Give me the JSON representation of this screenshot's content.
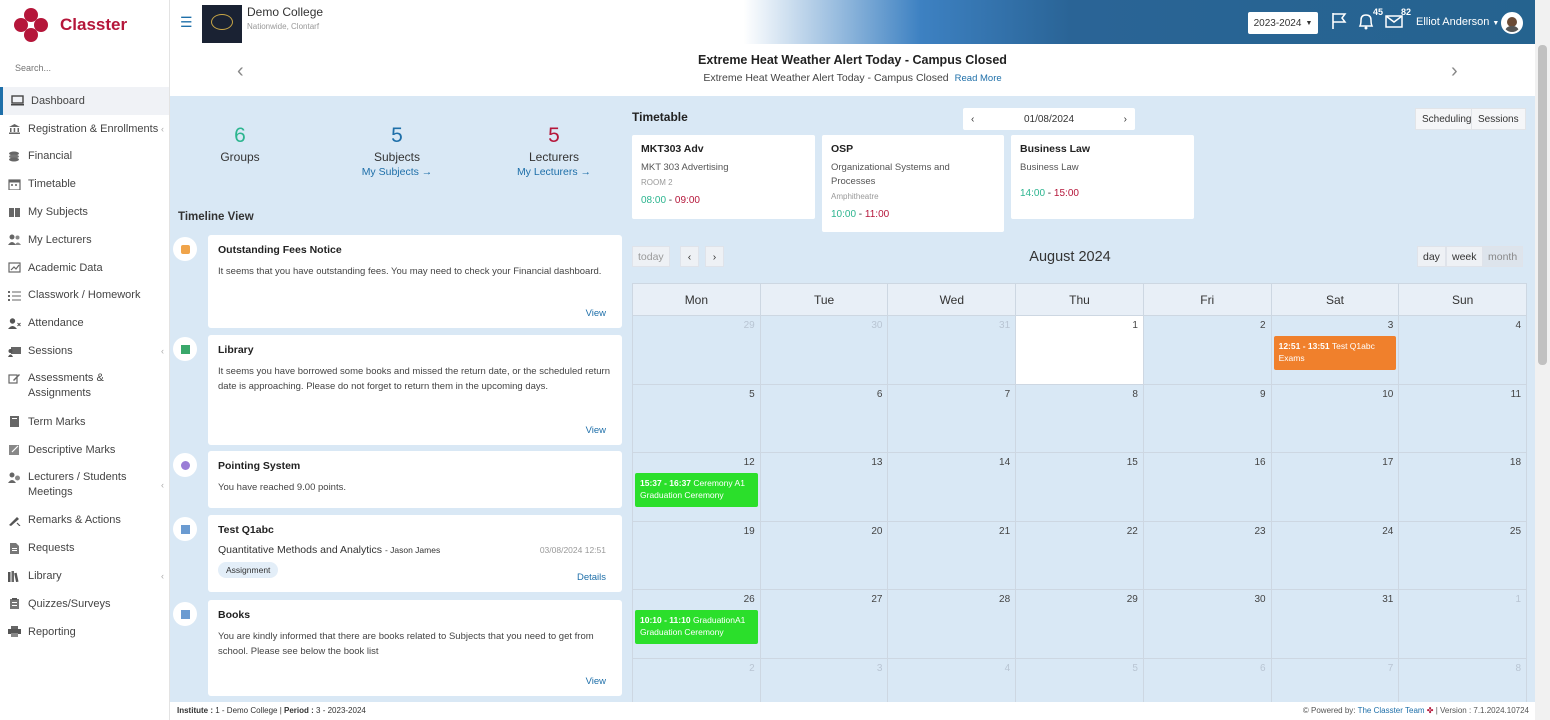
{
  "app": {
    "name": "Classter",
    "brand_color": "#b5163a",
    "accent_color": "#1e6fa9"
  },
  "sidebar": {
    "search_placeholder": "Search...",
    "items": [
      {
        "label": "Dashboard",
        "icon": "laptop-icon"
      },
      {
        "label": "Registration & Enrollments",
        "icon": "institution-icon"
      },
      {
        "label": "Financial",
        "icon": "coins-icon"
      },
      {
        "label": "Timetable",
        "icon": "calendar-icon"
      },
      {
        "label": "My Subjects",
        "icon": "book-icon"
      },
      {
        "label": "My Lecturers",
        "icon": "users-icon"
      },
      {
        "label": "Academic Data",
        "icon": "chart-icon"
      },
      {
        "label": "Classwork / Homework",
        "icon": "list-icon"
      },
      {
        "label": "Attendance",
        "icon": "user-x-icon"
      },
      {
        "label": "Sessions",
        "icon": "presentation-icon"
      },
      {
        "label": "Assessments & Assignments",
        "icon": "edit-icon"
      },
      {
        "label": "Term Marks",
        "icon": "book-icon"
      },
      {
        "label": "Descriptive Marks",
        "icon": "edit-icon"
      },
      {
        "label": "Lecturers / Students Meetings",
        "icon": "users-icon"
      },
      {
        "label": "Remarks & Actions",
        "icon": "pen-icon"
      },
      {
        "label": "Requests",
        "icon": "file-icon"
      },
      {
        "label": "Library",
        "icon": "books-icon"
      },
      {
        "label": "Quizzes/Surveys",
        "icon": "clipboard-icon"
      },
      {
        "label": "Reporting",
        "icon": "printer-icon"
      }
    ]
  },
  "header": {
    "college_name": "Demo College",
    "college_sub": "Nationwide, Clontarf",
    "year_select": "2023-2024",
    "notifications_count": "45",
    "messages_count": "82",
    "user_name": "Elliot Anderson"
  },
  "announcement": {
    "title": "Extreme Heat Weather Alert Today - Campus Closed",
    "subtitle": "Extreme Heat Weather Alert Today - Campus Closed",
    "read_more": "Read More"
  },
  "stats": [
    {
      "number": "6",
      "label": "Groups",
      "link": "",
      "color": "#2cb58f"
    },
    {
      "number": "5",
      "label": "Subjects",
      "link": "My Subjects  →",
      "color": "#1e6fa9"
    },
    {
      "number": "5",
      "label": "Lecturers",
      "link": "My Lecturers  →",
      "color": "#b5163a"
    }
  ],
  "timeline": {
    "title": "Timeline View",
    "cards": [
      {
        "title": "Outstanding Fees Notice",
        "body": "It seems that you have outstanding fees. You may need to check your Financial dashboard.",
        "action": "View"
      },
      {
        "title": "Library",
        "body": "It seems you have borrowed some books and missed the return date, or the scheduled return date is approaching. Please do not forget to return them in the upcoming days.",
        "action": "View"
      },
      {
        "title": "Pointing System",
        "body": "You have reached 9.00 points.",
        "action": ""
      },
      {
        "title": "Test Q1abc",
        "subject": "Quantitative Methods and Analytics",
        "lecturer": "- Jason James",
        "date": "03/08/2024 12:51",
        "tag": "Assignment",
        "action": "Details"
      },
      {
        "title": "Books",
        "body": "You are kindly informed that there are books related to Subjects that you need to get from school. Please see below the book list",
        "action": "View"
      }
    ]
  },
  "timetable": {
    "title": "Timetable",
    "date": "01/08/2024",
    "scheduling": "Scheduling",
    "sessions": "Sessions",
    "classes": [
      {
        "code": "MKT303 Adv",
        "name": "MKT 303 Advertising",
        "room": "ROOM 2",
        "start": "08:00",
        "end": "09:00"
      },
      {
        "code": "OSP",
        "name": "Organizational Systems and Processes",
        "room": "Amphitheatre",
        "start": "10:00",
        "end": "11:00"
      },
      {
        "code": "Business Law",
        "name": "Business Law",
        "room": "",
        "start": "14:00",
        "end": "15:00"
      }
    ]
  },
  "calendar": {
    "title": "August 2024",
    "today_btn": "today",
    "views": {
      "day": "day",
      "week": "week",
      "month": "month"
    },
    "weekdays": [
      "Mon",
      "Tue",
      "Wed",
      "Thu",
      "Fri",
      "Sat",
      "Sun"
    ],
    "weeks": [
      [
        "29",
        "30",
        "31",
        "1",
        "2",
        "3",
        "4"
      ],
      [
        "5",
        "6",
        "7",
        "8",
        "9",
        "10",
        "11"
      ],
      [
        "12",
        "13",
        "14",
        "15",
        "16",
        "17",
        "18"
      ],
      [
        "19",
        "20",
        "21",
        "22",
        "23",
        "24",
        "25"
      ],
      [
        "26",
        "27",
        "28",
        "29",
        "30",
        "31",
        "1"
      ],
      [
        "2",
        "3",
        "4",
        "5",
        "6",
        "7",
        "8"
      ]
    ],
    "events": [
      {
        "time": "12:51 - 13:51",
        "title": "Test Q1abc",
        "sub": "Exams",
        "color": "#f0802c"
      },
      {
        "time": "15:37 - 16:37",
        "title": "Ceremony A1",
        "sub": "Graduation Ceremony",
        "color": "#2bdf2b"
      },
      {
        "time": "10:10 - 11:10",
        "title": "GraduationA1",
        "sub": "Graduation Ceremony",
        "color": "#2bdf2b"
      }
    ]
  },
  "footer": {
    "institute_label": "Institute :",
    "institute": "1 - Demo College",
    "period_label": "Period :",
    "period": "3 - 2023-2024",
    "powered": "Powered by:",
    "team": "The Classter Team",
    "version": "| Version : 7.1.2024.10724"
  }
}
